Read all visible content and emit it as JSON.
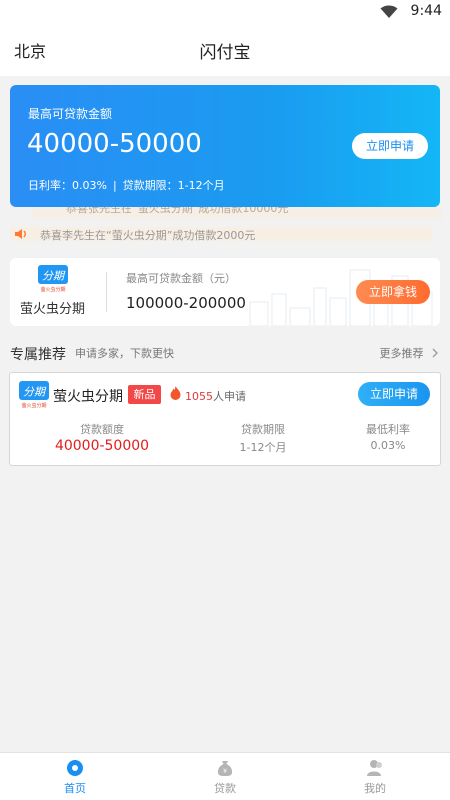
{
  "status": {
    "time": "9:44"
  },
  "header": {
    "city": "北京",
    "title": "闪付宝"
  },
  "hero": {
    "label": "最高可贷款金额",
    "amount": "40000-50000",
    "rate": "日利率：0.03%",
    "separator": "|",
    "term": "贷款期限：1-12个月",
    "button": "立即申请"
  },
  "notices": [
    "恭喜张先生在“萤火虫分期”成功借款10000元",
    "恭喜李先生在“萤火虫分期”成功借款2000元"
  ],
  "featured": {
    "logo_text": "分期",
    "logo_sub": "萤火虫分期",
    "name": "萤火虫分期",
    "label": "最高可贷款金额（元）",
    "amount": "100000-200000",
    "button": "立即拿钱"
  },
  "section": {
    "title": "专属推荐",
    "subtitle": "申请多家，下款更快",
    "more": "更多推荐"
  },
  "product": {
    "logo_text": "分期",
    "logo_sub": "萤火虫分期",
    "name": "萤火虫分期",
    "badge": "新品",
    "count_num": "1055",
    "count_suffix": "人申请",
    "button": "立即申请",
    "stats": [
      {
        "label": "贷款额度",
        "value": "40000-50000"
      },
      {
        "label": "贷款期限",
        "value": "1-12个月"
      },
      {
        "label": "最低利率",
        "value": "0.03%"
      }
    ]
  },
  "tabs": [
    {
      "label": "首页",
      "icon": "home-icon",
      "active": true
    },
    {
      "label": "贷款",
      "icon": "loan-bag-icon",
      "active": false
    },
    {
      "label": "我的",
      "icon": "user-icon",
      "active": false
    }
  ],
  "colors": {
    "primary": "#1a8ff2",
    "accent_orange": "#ff6b2e",
    "badge_red": "#f24848",
    "amount_red": "#e21d1d"
  }
}
